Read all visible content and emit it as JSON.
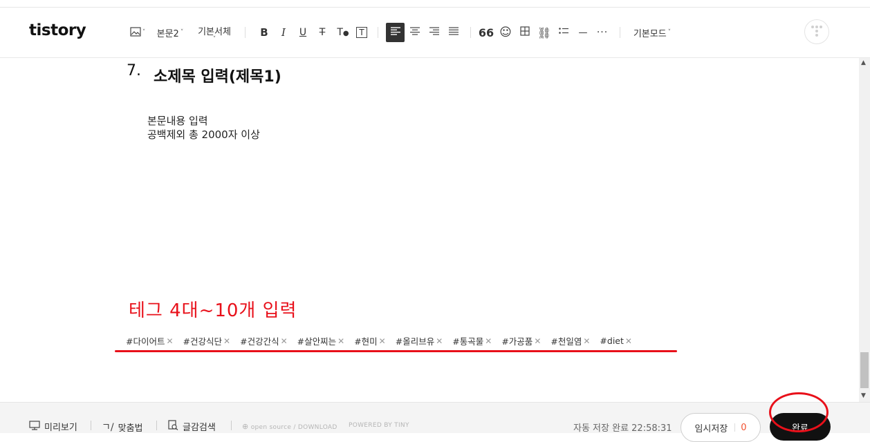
{
  "app": {
    "logo": "tistory"
  },
  "toolbar": {
    "paragraph_style": "본문2",
    "font_family": "기본서체",
    "mode": "기본모드"
  },
  "content": {
    "heading_number": "7.",
    "heading_text": "소제목 입력(제목1)",
    "body_lines": [
      "본문내용 입력",
      "공백제외 총 2000자 이상"
    ],
    "annotation": "테그 4대~10개 입력",
    "tags": [
      "#다이어트",
      "#건강식단",
      "#건강간식",
      "#살안찌는",
      "#현미",
      "#올리브유",
      "#통곡물",
      "#가공품",
      "#천일염",
      "#diet"
    ]
  },
  "footer": {
    "preview": "미리보기",
    "spellcheck": "맞춤법",
    "search": "글감검색",
    "opensource": "open source / DOWNLOAD",
    "powered": "POWERED BY TINY",
    "autosave": "자동 저장 완료 22:58:31",
    "temp_save": "임시저장",
    "temp_count": "0",
    "done": "완료"
  },
  "colors": {
    "annotation": "#e8101a",
    "primary_button": "#111111",
    "temp_count": "#f2502f"
  },
  "icons": [
    "image-icon",
    "bold-icon",
    "italic-icon",
    "underline-icon",
    "strikethrough-icon",
    "text-color-icon",
    "text-bg-icon",
    "align-left-icon",
    "align-center-icon",
    "align-right-icon",
    "align-justify-icon",
    "quote-icon",
    "emoji-icon",
    "table-icon",
    "link-icon",
    "list-icon",
    "divider-icon",
    "more-icon",
    "tistory-circle-icon",
    "monitor-icon",
    "spellcheck-icon",
    "search-doc-icon"
  ]
}
